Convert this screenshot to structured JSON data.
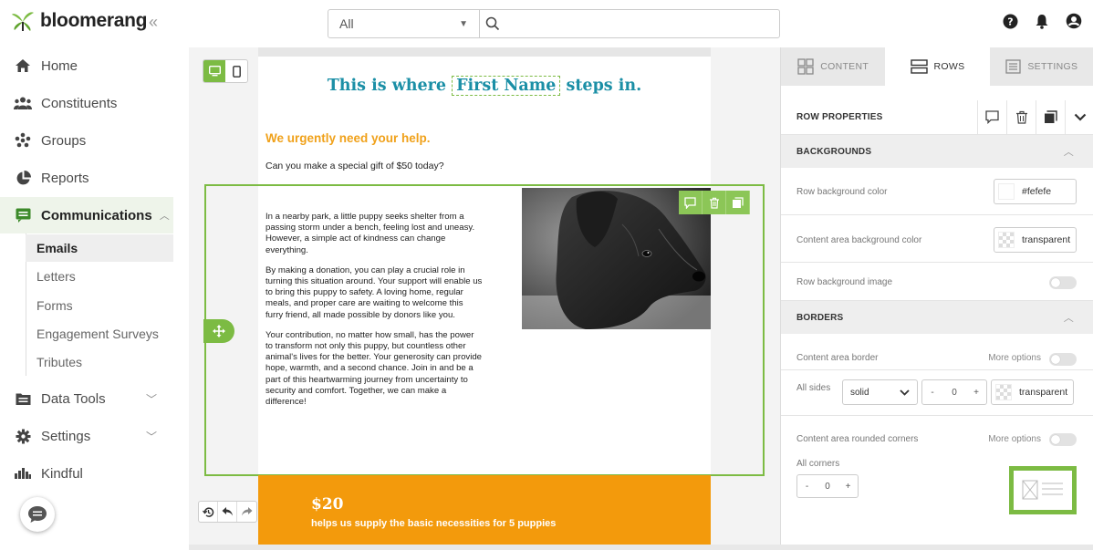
{
  "brand": {
    "name": "bloomerang",
    "accent": "#7cbb43",
    "headline_color": "#1b8fa6",
    "orange": "#f39a0c"
  },
  "topbar": {
    "collapse_glyph": "«",
    "search_scope": "All",
    "search_placeholder": "",
    "icons": [
      "help-icon",
      "bell-icon",
      "user-icon"
    ]
  },
  "sidebar": {
    "items": [
      {
        "label": "Home",
        "icon": "home-icon"
      },
      {
        "label": "Constituents",
        "icon": "people-icon"
      },
      {
        "label": "Groups",
        "icon": "groups-icon"
      },
      {
        "label": "Reports",
        "icon": "pie-chart-icon"
      },
      {
        "label": "Communications",
        "icon": "message-icon",
        "active": true,
        "expanded": true
      },
      {
        "label": "Data Tools",
        "icon": "data-tools-icon"
      },
      {
        "label": "Settings",
        "icon": "gear-icon"
      },
      {
        "label": "Kindful",
        "icon": "kindful-icon"
      }
    ],
    "sub_items": [
      {
        "label": "Emails",
        "active": true
      },
      {
        "label": "Letters"
      },
      {
        "label": "Forms"
      },
      {
        "label": "Engagement Surveys"
      },
      {
        "label": "Tributes"
      }
    ]
  },
  "email": {
    "headline_before": "This is where",
    "merge_field": "First Name",
    "headline_after": "steps in.",
    "urgent": "We urgently need your help.",
    "gift": "Can you make a special gift of $50 today?",
    "paragraphs": [
      "In a nearby park, a little puppy seeks shelter from a passing storm under a bench, feeling lost and uneasy. However, a simple act of kindness can change everything.",
      "By making a donation, you can play a crucial role in turning this situation around. Your support will enable us to bring this puppy to safety. A loving home, regular meals, and proper care are waiting to welcome this furry friend, all made possible by donors like you.",
      "Your contribution, no matter how small, has the power to transform not only this puppy, but countless other animal's lives for the better. Your generosity can provide hope, warmth, and a second chance. Join in and be a part of this heartwarming journey from uncertainty to security and comfort. Together, we can make a difference!"
    ],
    "donate_amount": "$20",
    "donate_text": "helps us supply the basic necessities for 5 puppies"
  },
  "panel": {
    "tabs": [
      {
        "label": "CONTENT",
        "icon": "grid-icon"
      },
      {
        "label": "ROWS",
        "icon": "rows-icon",
        "active": true
      },
      {
        "label": "SETTINGS",
        "icon": "settings-doc-icon"
      }
    ],
    "row_properties": "ROW PROPERTIES",
    "backgrounds": "BACKGROUNDS",
    "row_bg_label": "Row background color",
    "row_bg_value": "#fefefe",
    "content_bg_label": "Content area background color",
    "content_bg_value": "transparent",
    "row_bg_image_label": "Row background image",
    "borders": "BORDERS",
    "content_border_label": "Content area border",
    "more_options": "More options",
    "all_sides": "All sides",
    "border_style": "solid",
    "border_width": "0",
    "border_color": "transparent",
    "rounded_label": "Content area rounded corners",
    "all_corners": "All corners",
    "corner_value": "0",
    "minus": "-",
    "plus": "+"
  }
}
